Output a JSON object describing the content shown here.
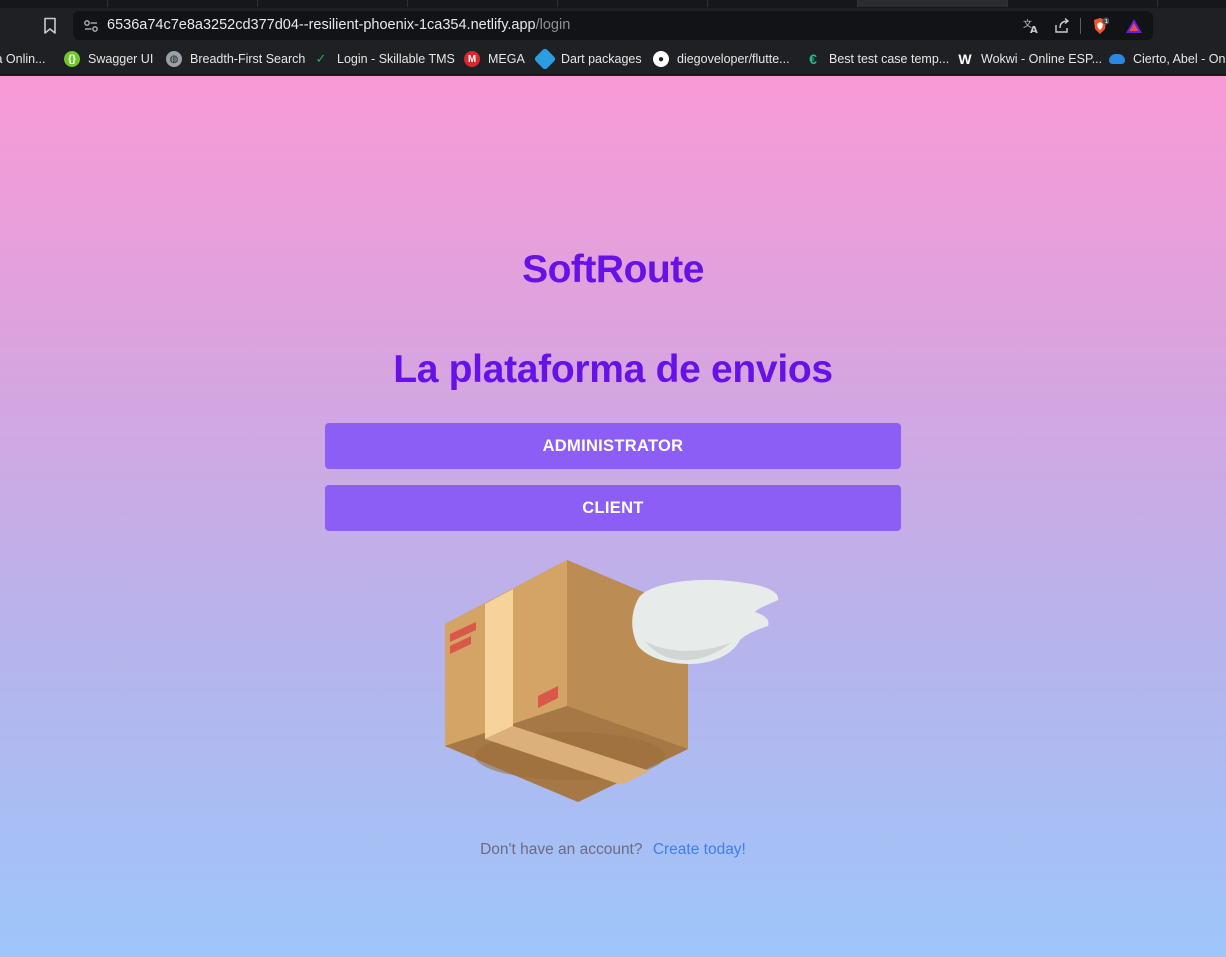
{
  "browser": {
    "url_host": "6536a74c7e8a3252cd377d04--resilient-phoenix-1ca354.netlify.app",
    "url_path": "/login",
    "bookmarks": [
      {
        "label": "ía Onlin...",
        "icon": "document-icon",
        "color": "#8a8a8a"
      },
      {
        "label": "Swagger UI",
        "icon": "swagger-icon",
        "color": "#7bd23a"
      },
      {
        "label": "Breadth-First Search",
        "icon": "globe-icon",
        "color": "#9aa0a6"
      },
      {
        "label": "Login - Skillable TMS",
        "icon": "checkmark-icon",
        "color": "#1db35b"
      },
      {
        "label": "MEGA",
        "icon": "mega-icon",
        "color": "#d9272e"
      },
      {
        "label": "Dart packages",
        "icon": "dart-icon",
        "color": "#2a9ee0"
      },
      {
        "label": "diegoveloper/flutte...",
        "icon": "github-icon",
        "color": "#ffffff"
      },
      {
        "label": "Best test case temp...",
        "icon": "euro-icon",
        "color": "#1ec28b"
      },
      {
        "label": "Wokwi - Online ESP...",
        "icon": "wokwi-icon",
        "color": "#ffffff"
      },
      {
        "label": "Cierto, Abel - One",
        "icon": "onedrive-icon",
        "color": "#2b88e0"
      }
    ]
  },
  "page": {
    "brand": "SoftRoute",
    "tagline": "La plataforma de envios",
    "admin_button": "ADMINISTRATOR",
    "client_button": "CLIENT",
    "signup_prompt": "Don't have an account?",
    "signup_link": "Create today!"
  },
  "colors": {
    "accent": "#6611e6",
    "button": "#8c5ef6",
    "link": "#3f7fe6"
  }
}
